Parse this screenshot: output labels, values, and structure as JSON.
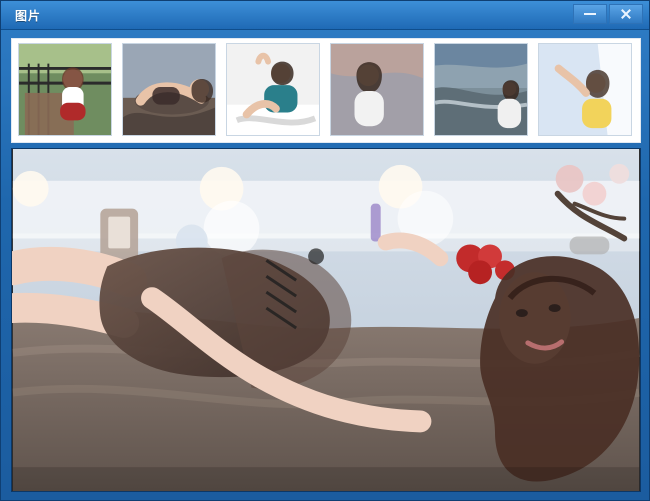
{
  "window": {
    "title": "图片"
  },
  "titlebar": {
    "buttons": [
      {
        "name": "minimize",
        "icon": "minimize-icon"
      },
      {
        "name": "close",
        "icon": "close-icon"
      }
    ]
  },
  "colors": {
    "chrome_blue": "#1f67ad",
    "strip_bg": "#ffffff"
  },
  "thumbnails": [
    {
      "icon": "photo-thumbnail-1"
    },
    {
      "icon": "photo-thumbnail-2"
    },
    {
      "icon": "photo-thumbnail-3"
    },
    {
      "icon": "photo-thumbnail-4"
    },
    {
      "icon": "photo-thumbnail-5"
    },
    {
      "icon": "photo-thumbnail-6"
    }
  ],
  "viewer": {
    "image": "main-photo"
  }
}
